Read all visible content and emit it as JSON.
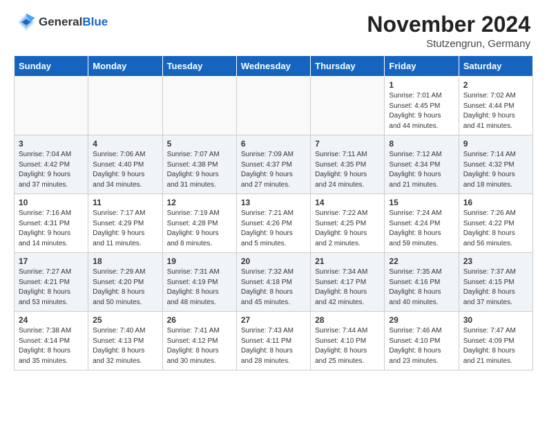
{
  "header": {
    "logo_general": "General",
    "logo_blue": "Blue",
    "month_title": "November 2024",
    "location": "Stutzengrun, Germany"
  },
  "weekdays": [
    "Sunday",
    "Monday",
    "Tuesday",
    "Wednesday",
    "Thursday",
    "Friday",
    "Saturday"
  ],
  "weeks": [
    [
      {
        "day": "",
        "info": ""
      },
      {
        "day": "",
        "info": ""
      },
      {
        "day": "",
        "info": ""
      },
      {
        "day": "",
        "info": ""
      },
      {
        "day": "",
        "info": ""
      },
      {
        "day": "1",
        "info": "Sunrise: 7:01 AM\nSunset: 4:45 PM\nDaylight: 9 hours\nand 44 minutes."
      },
      {
        "day": "2",
        "info": "Sunrise: 7:02 AM\nSunset: 4:44 PM\nDaylight: 9 hours\nand 41 minutes."
      }
    ],
    [
      {
        "day": "3",
        "info": "Sunrise: 7:04 AM\nSunset: 4:42 PM\nDaylight: 9 hours\nand 37 minutes."
      },
      {
        "day": "4",
        "info": "Sunrise: 7:06 AM\nSunset: 4:40 PM\nDaylight: 9 hours\nand 34 minutes."
      },
      {
        "day": "5",
        "info": "Sunrise: 7:07 AM\nSunset: 4:38 PM\nDaylight: 9 hours\nand 31 minutes."
      },
      {
        "day": "6",
        "info": "Sunrise: 7:09 AM\nSunset: 4:37 PM\nDaylight: 9 hours\nand 27 minutes."
      },
      {
        "day": "7",
        "info": "Sunrise: 7:11 AM\nSunset: 4:35 PM\nDaylight: 9 hours\nand 24 minutes."
      },
      {
        "day": "8",
        "info": "Sunrise: 7:12 AM\nSunset: 4:34 PM\nDaylight: 9 hours\nand 21 minutes."
      },
      {
        "day": "9",
        "info": "Sunrise: 7:14 AM\nSunset: 4:32 PM\nDaylight: 9 hours\nand 18 minutes."
      }
    ],
    [
      {
        "day": "10",
        "info": "Sunrise: 7:16 AM\nSunset: 4:31 PM\nDaylight: 9 hours\nand 14 minutes."
      },
      {
        "day": "11",
        "info": "Sunrise: 7:17 AM\nSunset: 4:29 PM\nDaylight: 9 hours\nand 11 minutes."
      },
      {
        "day": "12",
        "info": "Sunrise: 7:19 AM\nSunset: 4:28 PM\nDaylight: 9 hours\nand 8 minutes."
      },
      {
        "day": "13",
        "info": "Sunrise: 7:21 AM\nSunset: 4:26 PM\nDaylight: 9 hours\nand 5 minutes."
      },
      {
        "day": "14",
        "info": "Sunrise: 7:22 AM\nSunset: 4:25 PM\nDaylight: 9 hours\nand 2 minutes."
      },
      {
        "day": "15",
        "info": "Sunrise: 7:24 AM\nSunset: 4:24 PM\nDaylight: 8 hours\nand 59 minutes."
      },
      {
        "day": "16",
        "info": "Sunrise: 7:26 AM\nSunset: 4:22 PM\nDaylight: 8 hours\nand 56 minutes."
      }
    ],
    [
      {
        "day": "17",
        "info": "Sunrise: 7:27 AM\nSunset: 4:21 PM\nDaylight: 8 hours\nand 53 minutes."
      },
      {
        "day": "18",
        "info": "Sunrise: 7:29 AM\nSunset: 4:20 PM\nDaylight: 8 hours\nand 50 minutes."
      },
      {
        "day": "19",
        "info": "Sunrise: 7:31 AM\nSunset: 4:19 PM\nDaylight: 8 hours\nand 48 minutes."
      },
      {
        "day": "20",
        "info": "Sunrise: 7:32 AM\nSunset: 4:18 PM\nDaylight: 8 hours\nand 45 minutes."
      },
      {
        "day": "21",
        "info": "Sunrise: 7:34 AM\nSunset: 4:17 PM\nDaylight: 8 hours\nand 42 minutes."
      },
      {
        "day": "22",
        "info": "Sunrise: 7:35 AM\nSunset: 4:16 PM\nDaylight: 8 hours\nand 40 minutes."
      },
      {
        "day": "23",
        "info": "Sunrise: 7:37 AM\nSunset: 4:15 PM\nDaylight: 8 hours\nand 37 minutes."
      }
    ],
    [
      {
        "day": "24",
        "info": "Sunrise: 7:38 AM\nSunset: 4:14 PM\nDaylight: 8 hours\nand 35 minutes."
      },
      {
        "day": "25",
        "info": "Sunrise: 7:40 AM\nSunset: 4:13 PM\nDaylight: 8 hours\nand 32 minutes."
      },
      {
        "day": "26",
        "info": "Sunrise: 7:41 AM\nSunset: 4:12 PM\nDaylight: 8 hours\nand 30 minutes."
      },
      {
        "day": "27",
        "info": "Sunrise: 7:43 AM\nSunset: 4:11 PM\nDaylight: 8 hours\nand 28 minutes."
      },
      {
        "day": "28",
        "info": "Sunrise: 7:44 AM\nSunset: 4:10 PM\nDaylight: 8 hours\nand 25 minutes."
      },
      {
        "day": "29",
        "info": "Sunrise: 7:46 AM\nSunset: 4:10 PM\nDaylight: 8 hours\nand 23 minutes."
      },
      {
        "day": "30",
        "info": "Sunrise: 7:47 AM\nSunset: 4:09 PM\nDaylight: 8 hours\nand 21 minutes."
      }
    ]
  ]
}
